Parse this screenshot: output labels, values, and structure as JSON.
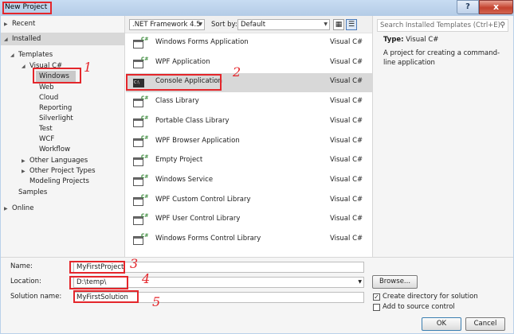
{
  "window": {
    "title": "New Project",
    "help": "?",
    "close": "x"
  },
  "tree": {
    "recent": "Recent",
    "installed": "Installed",
    "templates": "Templates",
    "visual_csharp": "Visual C#",
    "items": [
      "Windows",
      "Web",
      "Cloud",
      "Reporting",
      "Silverlight",
      "Test",
      "WCF",
      "Workflow"
    ],
    "other_languages": "Other Languages",
    "other_project_types": "Other Project Types",
    "modeling_projects": "Modeling Projects",
    "samples": "Samples",
    "online": "Online"
  },
  "toolbar": {
    "framework": ".NET Framework 4.5",
    "sort_label": "Sort by:",
    "sort_value": "Default"
  },
  "templates": [
    {
      "name": "Windows Forms Application",
      "lang": "Visual C#"
    },
    {
      "name": "WPF Application",
      "lang": "Visual C#"
    },
    {
      "name": "Console Application",
      "lang": "Visual C#"
    },
    {
      "name": "Class Library",
      "lang": "Visual C#"
    },
    {
      "name": "Portable Class Library",
      "lang": "Visual C#"
    },
    {
      "name": "WPF Browser Application",
      "lang": "Visual C#"
    },
    {
      "name": "Empty Project",
      "lang": "Visual C#"
    },
    {
      "name": "Windows Service",
      "lang": "Visual C#"
    },
    {
      "name": "WPF Custom Control Library",
      "lang": "Visual C#"
    },
    {
      "name": "WPF User Control Library",
      "lang": "Visual C#"
    },
    {
      "name": "Windows Forms Control Library",
      "lang": "Visual C#"
    }
  ],
  "details": {
    "search_placeholder": "Search Installed Templates (Ctrl+E)",
    "type_label": "Type:",
    "type_value": "Visual C#",
    "description": "A project for creating a command-line application"
  },
  "form": {
    "name_label": "Name:",
    "name_value": "MyFirstProject",
    "location_label": "Location:",
    "location_value": "D:\\temp\\",
    "solution_label": "Solution name:",
    "solution_value": "MyFirstSolution",
    "browse": "Browse...",
    "create_dir": "Create directory for solution",
    "add_source": "Add to source control",
    "create_dir_checked": true,
    "add_source_checked": false,
    "ok": "OK",
    "cancel": "Cancel"
  },
  "annotations": {
    "n1": "1",
    "n2": "2",
    "n3": "3",
    "n4": "4",
    "n5": "5"
  }
}
